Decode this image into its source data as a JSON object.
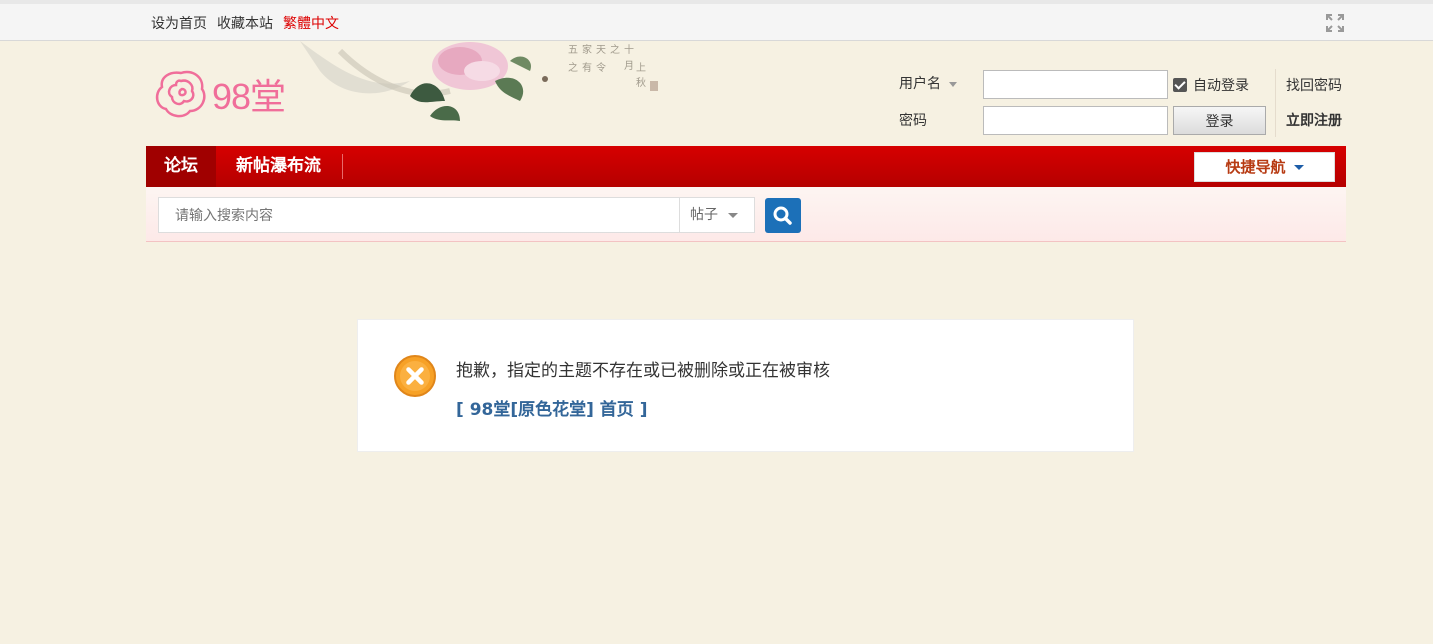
{
  "topbar": {
    "set_home": "设为首页",
    "bookmark": "收藏本站",
    "traditional": "繁體中文"
  },
  "logo": {
    "text": "98堂"
  },
  "login": {
    "username_label": "用户名",
    "password_label": "密码",
    "username_value": "",
    "password_value": "",
    "auto_login": "自动登录",
    "auto_login_checked": true,
    "find_password": "找回密码",
    "login_button": "登录",
    "register": "立即注册"
  },
  "nav": {
    "items": [
      {
        "label": "论坛",
        "active": true
      },
      {
        "label": "新帖瀑布流",
        "active": false
      }
    ],
    "quick_nav": "快捷导航"
  },
  "search": {
    "placeholder": "请输入搜索内容",
    "type_value": "帖子"
  },
  "message": {
    "text": "抱歉，指定的主题不存在或已被删除或正在被审核",
    "home_link": "[ 98堂[原色花堂] 首页 ]"
  },
  "colors": {
    "nav_red": "#c40000",
    "link_blue": "#336699",
    "error_orange": "#f39c12",
    "quick_nav_text": "#b73a12",
    "search_button": "#1c70b8"
  }
}
